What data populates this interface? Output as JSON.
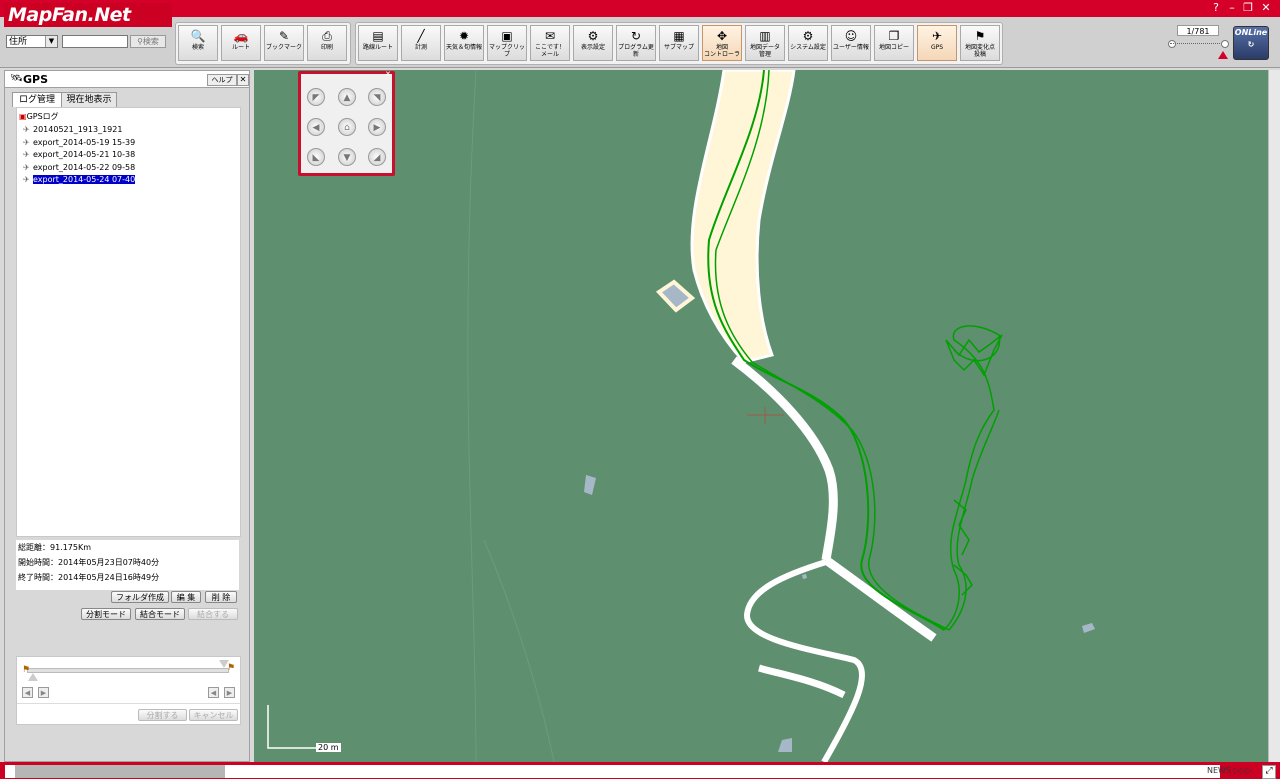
{
  "window": {
    "controls": [
      "?",
      "–",
      "❐",
      "✕"
    ]
  },
  "logo": "MapFan.Net",
  "search": {
    "mode": "住所",
    "value": "",
    "button": "検索"
  },
  "toolbar_main": [
    {
      "label": "検索",
      "icon": "magnifier-icon"
    },
    {
      "label": "ルート",
      "icon": "car-icon"
    },
    {
      "label": "ブックマーク",
      "icon": "bookmark-icon"
    },
    {
      "label": "印刷",
      "icon": "printer-icon"
    }
  ],
  "toolbar_tools": [
    {
      "label": "路線ルート",
      "icon": "train-icon"
    },
    {
      "label": "計測",
      "icon": "ruler-icon"
    },
    {
      "label": "天気＆旬情報",
      "icon": "sun-icon"
    },
    {
      "label": "マップクリップ",
      "icon": "clip-icon"
    },
    {
      "label": "ここです！\nメール",
      "icon": "mail-icon"
    },
    {
      "label": "表示設定",
      "icon": "display-icon"
    },
    {
      "label": "プログラム更新",
      "icon": "update-icon"
    },
    {
      "label": "サブマップ",
      "icon": "submap-icon"
    },
    {
      "label": "地図\nコントローラ",
      "icon": "controller-icon",
      "active": true
    },
    {
      "label": "地図データ\n管理",
      "icon": "data-icon"
    },
    {
      "label": "システム設定",
      "icon": "gear-icon"
    },
    {
      "label": "ユーザー情報",
      "icon": "user-icon"
    },
    {
      "label": "地図コピー",
      "icon": "copy-icon"
    },
    {
      "label": "GPS",
      "icon": "gps-satellite-icon",
      "active": true
    },
    {
      "label": "地図変化点\n投稿",
      "icon": "post-icon"
    }
  ],
  "zoom": {
    "scale": "1/781"
  },
  "online_badge": "ONLine",
  "panel": {
    "title": "GPS",
    "help": "ヘルプ",
    "close": "✕",
    "tabs": [
      "ログ管理",
      "現在地表示"
    ],
    "tree_root": "GPSログ",
    "logs": [
      "20140521_1913_1921",
      "export_2014-05-19 15-39",
      "export_2014-05-21 10-38",
      "export_2014-05-22 09-58",
      "export_2014-05-24 07-40"
    ],
    "selected_index": 4,
    "stats": {
      "distance": "総距離：91.175Km",
      "start": "開始時間：2014年05月23日07時40分",
      "end": "終了時間：2014年05月24日16時49分"
    },
    "buttons_row1": [
      "フォルダ作成",
      "編 集",
      "削 除"
    ],
    "buttons_row2": [
      "分割モード",
      "結合モード",
      "結合する"
    ],
    "slider_buttons": [
      "分割する",
      "キャンセル"
    ]
  },
  "map": {
    "scale_label": "20 m",
    "colors": {
      "ground": "#5e8f6f",
      "road": "#ffffff",
      "track": "#00a000",
      "riverbank": "#fff6d8"
    }
  },
  "statusbar": {
    "news": "NEWS ▷▷▷"
  }
}
